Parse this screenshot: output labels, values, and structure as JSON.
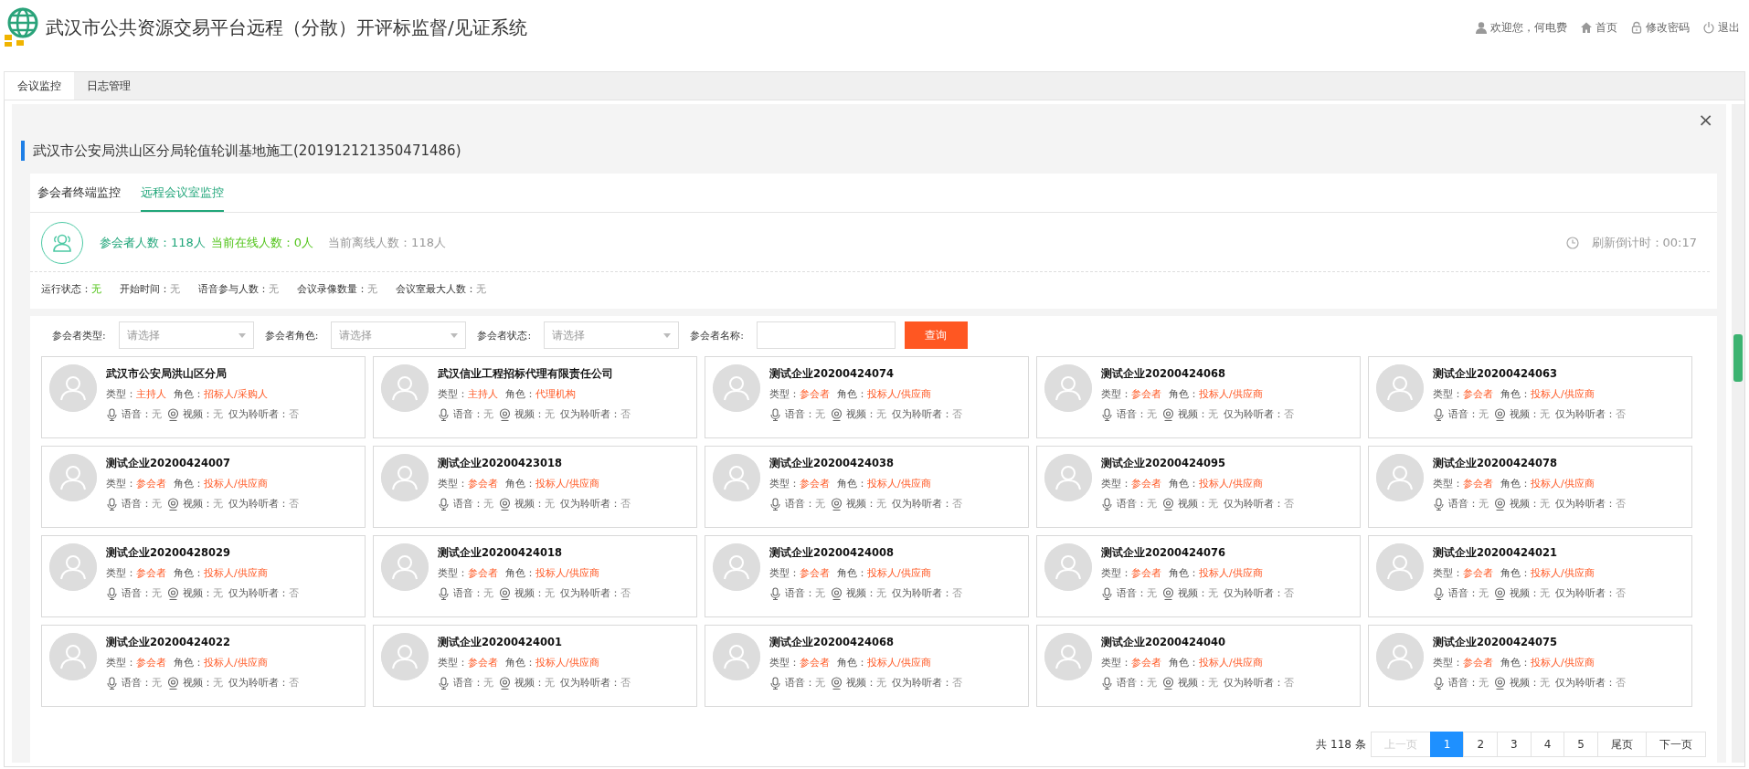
{
  "header": {
    "title": "武汉市公共资源交易平台远程（分散）开评标监督/见证系统",
    "links": [
      {
        "kind": "user",
        "label": "欢迎您，何电费"
      },
      {
        "kind": "home",
        "label": "首页"
      },
      {
        "kind": "lock",
        "label": "修改密码"
      },
      {
        "kind": "power",
        "label": "退出"
      }
    ]
  },
  "tabs": [
    {
      "label": "会议监控",
      "selected": true
    },
    {
      "label": "日志管理",
      "selected": false
    }
  ],
  "panel": {
    "close": "×",
    "project_title": "武汉市公安局洪山区分局轮值轮训基地施工(201912121350471486)",
    "sub_tabs": [
      {
        "label": "参会者终端监控",
        "selected": false
      },
      {
        "label": "远程会议室监控",
        "selected": true
      }
    ],
    "stats": [
      {
        "kind": "total",
        "text": "参会者人数：118人"
      },
      {
        "kind": "online",
        "text": "当前在线人数：0人"
      },
      {
        "kind": "offline",
        "text": "当前离线人数：118人"
      }
    ],
    "countdown": "刷新倒计时：00:17",
    "status": [
      {
        "label": "运行状态：",
        "value": "无",
        "kind": "ok"
      },
      {
        "label": "开始时间：",
        "value": "无",
        "kind": "plain"
      },
      {
        "label": "语音参与人数：",
        "value": "无",
        "kind": "plain"
      },
      {
        "label": "会议录像数量：",
        "value": "无",
        "kind": "plain"
      },
      {
        "label": "会议室最大人数：",
        "value": "无",
        "kind": "plain"
      }
    ],
    "filters": [
      {
        "kind": "select",
        "label": "参会者类型:",
        "placeholder": "请选择"
      },
      {
        "kind": "select",
        "label": "参会者角色:",
        "placeholder": "请选择"
      },
      {
        "kind": "select",
        "label": "参会者状态:",
        "placeholder": "请选择"
      },
      {
        "kind": "text",
        "label": "参会者名称:"
      }
    ],
    "search_button": "查询",
    "cards": [
      {
        "name": "武汉市公安局洪山区分局",
        "type_label": "类型：",
        "type": "主持人",
        "role_label": "角色：",
        "role": "招标人/采购人",
        "audio_label": "语音：",
        "audio": "无",
        "video_label": "视频：",
        "video": "无",
        "listener_label": "仅为聆听者：",
        "listener": "否"
      },
      {
        "name": "武汉信业工程招标代理有限责任公司",
        "type_label": "类型：",
        "type": "主持人",
        "role_label": "角色：",
        "role": "代理机构",
        "audio_label": "语音：",
        "audio": "无",
        "video_label": "视频：",
        "video": "无",
        "listener_label": "仅为聆听者：",
        "listener": "否"
      },
      {
        "name": "测试企业20200424074",
        "type_label": "类型：",
        "type": "参会者",
        "role_label": "角色：",
        "role": "投标人/供应商",
        "audio_label": "语音：",
        "audio": "无",
        "video_label": "视频：",
        "video": "无",
        "listener_label": "仅为聆听者：",
        "listener": "否"
      },
      {
        "name": "测试企业20200424068",
        "type_label": "类型：",
        "type": "参会者",
        "role_label": "角色：",
        "role": "投标人/供应商",
        "audio_label": "语音：",
        "audio": "无",
        "video_label": "视频：",
        "video": "无",
        "listener_label": "仅为聆听者：",
        "listener": "否"
      },
      {
        "name": "测试企业20200424063",
        "type_label": "类型：",
        "type": "参会者",
        "role_label": "角色：",
        "role": "投标人/供应商",
        "audio_label": "语音：",
        "audio": "无",
        "video_label": "视频：",
        "video": "无",
        "listener_label": "仅为聆听者：",
        "listener": "否"
      },
      {
        "name": "测试企业20200424007",
        "type_label": "类型：",
        "type": "参会者",
        "role_label": "角色：",
        "role": "投标人/供应商",
        "audio_label": "语音：",
        "audio": "无",
        "video_label": "视频：",
        "video": "无",
        "listener_label": "仅为聆听者：",
        "listener": "否"
      },
      {
        "name": "测试企业20200423018",
        "type_label": "类型：",
        "type": "参会者",
        "role_label": "角色：",
        "role": "投标人/供应商",
        "audio_label": "语音：",
        "audio": "无",
        "video_label": "视频：",
        "video": "无",
        "listener_label": "仅为聆听者：",
        "listener": "否"
      },
      {
        "name": "测试企业20200424038",
        "type_label": "类型：",
        "type": "参会者",
        "role_label": "角色：",
        "role": "投标人/供应商",
        "audio_label": "语音：",
        "audio": "无",
        "video_label": "视频：",
        "video": "无",
        "listener_label": "仅为聆听者：",
        "listener": "否"
      },
      {
        "name": "测试企业20200424095",
        "type_label": "类型：",
        "type": "参会者",
        "role_label": "角色：",
        "role": "投标人/供应商",
        "audio_label": "语音：",
        "audio": "无",
        "video_label": "视频：",
        "video": "无",
        "listener_label": "仅为聆听者：",
        "listener": "否"
      },
      {
        "name": "测试企业20200424078",
        "type_label": "类型：",
        "type": "参会者",
        "role_label": "角色：",
        "role": "投标人/供应商",
        "audio_label": "语音：",
        "audio": "无",
        "video_label": "视频：",
        "video": "无",
        "listener_label": "仅为聆听者：",
        "listener": "否"
      },
      {
        "name": "测试企业20200428029",
        "type_label": "类型：",
        "type": "参会者",
        "role_label": "角色：",
        "role": "投标人/供应商",
        "audio_label": "语音：",
        "audio": "无",
        "video_label": "视频：",
        "video": "无",
        "listener_label": "仅为聆听者：",
        "listener": "否"
      },
      {
        "name": "测试企业20200424018",
        "type_label": "类型：",
        "type": "参会者",
        "role_label": "角色：",
        "role": "投标人/供应商",
        "audio_label": "语音：",
        "audio": "无",
        "video_label": "视频：",
        "video": "无",
        "listener_label": "仅为聆听者：",
        "listener": "否"
      },
      {
        "name": "测试企业20200424008",
        "type_label": "类型：",
        "type": "参会者",
        "role_label": "角色：",
        "role": "投标人/供应商",
        "audio_label": "语音：",
        "audio": "无",
        "video_label": "视频：",
        "video": "无",
        "listener_label": "仅为聆听者：",
        "listener": "否"
      },
      {
        "name": "测试企业20200424076",
        "type_label": "类型：",
        "type": "参会者",
        "role_label": "角色：",
        "role": "投标人/供应商",
        "audio_label": "语音：",
        "audio": "无",
        "video_label": "视频：",
        "video": "无",
        "listener_label": "仅为聆听者：",
        "listener": "否"
      },
      {
        "name": "测试企业20200424021",
        "type_label": "类型：",
        "type": "参会者",
        "role_label": "角色：",
        "role": "投标人/供应商",
        "audio_label": "语音：",
        "audio": "无",
        "video_label": "视频：",
        "video": "无",
        "listener_label": "仅为聆听者：",
        "listener": "否"
      },
      {
        "name": "测试企业20200424022",
        "type_label": "类型：",
        "type": "参会者",
        "role_label": "角色：",
        "role": "投标人/供应商",
        "audio_label": "语音：",
        "audio": "无",
        "video_label": "视频：",
        "video": "无",
        "listener_label": "仅为聆听者：",
        "listener": "否"
      },
      {
        "name": "测试企业20200424001",
        "type_label": "类型：",
        "type": "参会者",
        "role_label": "角色：",
        "role": "投标人/供应商",
        "audio_label": "语音：",
        "audio": "无",
        "video_label": "视频：",
        "video": "无",
        "listener_label": "仅为聆听者：",
        "listener": "否"
      },
      {
        "name": "测试企业20200424068",
        "type_label": "类型：",
        "type": "参会者",
        "role_label": "角色：",
        "role": "投标人/供应商",
        "audio_label": "语音：",
        "audio": "无",
        "video_label": "视频：",
        "video": "无",
        "listener_label": "仅为聆听者：",
        "listener": "否"
      },
      {
        "name": "测试企业20200424040",
        "type_label": "类型：",
        "type": "参会者",
        "role_label": "角色：",
        "role": "投标人/供应商",
        "audio_label": "语音：",
        "audio": "无",
        "video_label": "视频：",
        "video": "无",
        "listener_label": "仅为聆听者：",
        "listener": "否"
      },
      {
        "name": "测试企业20200424075",
        "type_label": "类型：",
        "type": "参会者",
        "role_label": "角色：",
        "role": "投标人/供应商",
        "audio_label": "语音：",
        "audio": "无",
        "video_label": "视频：",
        "video": "无",
        "listener_label": "仅为聆听者：",
        "listener": "否"
      }
    ],
    "pagination": {
      "total": "共 118 条",
      "pages": [
        {
          "label": "上一页",
          "disabled": true,
          "selected": false
        },
        {
          "label": "1",
          "disabled": false,
          "selected": true
        },
        {
          "label": "2",
          "disabled": false,
          "selected": false
        },
        {
          "label": "3",
          "disabled": false,
          "selected": false
        },
        {
          "label": "4",
          "disabled": false,
          "selected": false
        },
        {
          "label": "5",
          "disabled": false,
          "selected": false
        },
        {
          "label": "尾页",
          "disabled": false,
          "selected": false
        },
        {
          "label": "下一页",
          "disabled": false,
          "selected": false
        }
      ]
    }
  }
}
